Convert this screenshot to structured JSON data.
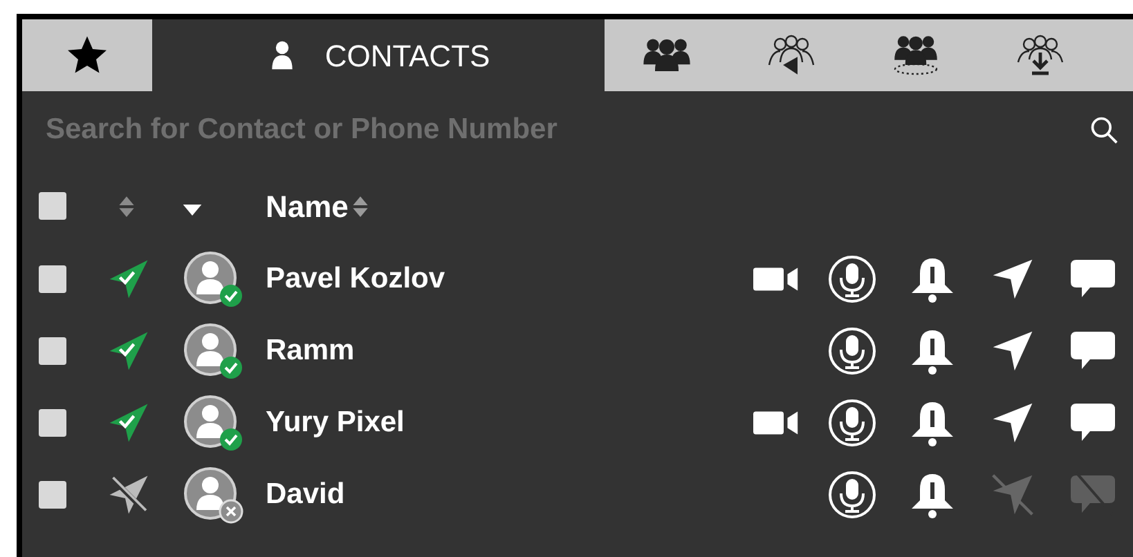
{
  "tabs": [
    {
      "kind": "favorites",
      "selected": false
    },
    {
      "kind": "contacts",
      "label": "CONTACTS",
      "selected": true
    },
    {
      "kind": "groups",
      "selected": false
    },
    {
      "kind": "broadcast",
      "selected": false
    },
    {
      "kind": "conference",
      "selected": false
    },
    {
      "kind": "import",
      "selected": false
    }
  ],
  "search": {
    "placeholder": "Search for Contact or Phone Number"
  },
  "header": {
    "select_all_checked": false,
    "label": "Name"
  },
  "contacts": [
    {
      "name": "Pavel Kozlov",
      "checked": false,
      "online": true,
      "video": true,
      "location": true,
      "chat": true
    },
    {
      "name": "Ramm",
      "checked": false,
      "online": true,
      "video": false,
      "location": true,
      "chat": true
    },
    {
      "name": "Yury Pixel",
      "checked": false,
      "online": true,
      "video": true,
      "location": true,
      "chat": true
    },
    {
      "name": "David",
      "checked": false,
      "online": false,
      "video": false,
      "location": false,
      "chat": false
    }
  ]
}
